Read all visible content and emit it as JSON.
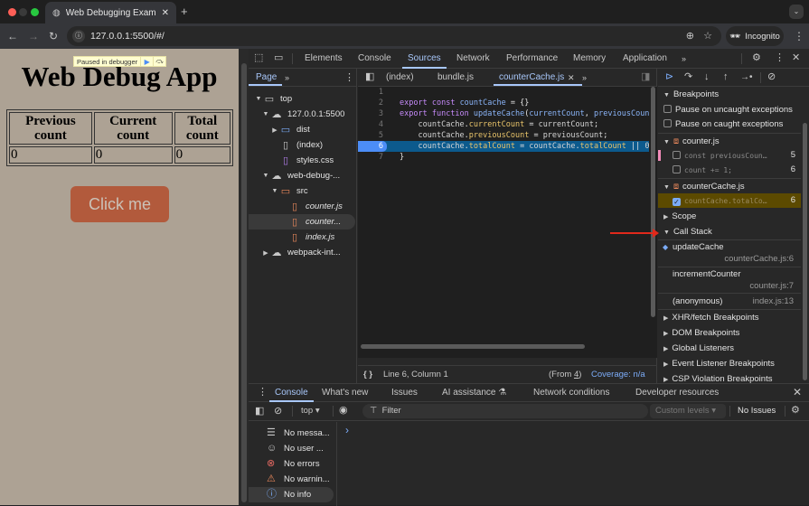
{
  "browser": {
    "tab_title": "Web Debugging Example",
    "url": "127.0.0.1:5500/#/",
    "incognito_label": "Incognito",
    "colors": {
      "close": "#ff5f57",
      "minimize": "#3a3a3a",
      "maximize": "#28c840"
    }
  },
  "page": {
    "paused_label": "Paused in debugger",
    "heading": "Web Debug App",
    "table": {
      "headers": [
        [
          "Previous",
          "count"
        ],
        [
          "Current",
          "count"
        ],
        [
          "Total",
          "count"
        ]
      ],
      "values": [
        "0",
        "0",
        "0"
      ]
    },
    "button_label": "Click me",
    "colors": {
      "background": "#ada294",
      "button": "#b25a3c"
    }
  },
  "devtools": {
    "main_tabs": [
      "Elements",
      "Console",
      "Sources",
      "Network",
      "Performance",
      "Memory",
      "Application"
    ],
    "active_main_tab": "Sources",
    "navigator": {
      "tab": "Page",
      "tree": [
        {
          "label": "top",
          "type": "frame",
          "expanded": true
        },
        {
          "label": "127.0.0.1:5500",
          "type": "domain",
          "expanded": true
        },
        {
          "label": "dist",
          "type": "folder",
          "expanded": false
        },
        {
          "label": "(index)",
          "type": "file"
        },
        {
          "label": "styles.css",
          "type": "css"
        },
        {
          "label": "web-debug-...",
          "type": "domain",
          "expanded": true
        },
        {
          "label": "src",
          "type": "folder",
          "expanded": true
        },
        {
          "label": "counter.js",
          "type": "js"
        },
        {
          "label": "counter...",
          "type": "js",
          "selected": true
        },
        {
          "label": "index.js",
          "type": "js"
        },
        {
          "label": "webpack-int...",
          "type": "domain",
          "expanded": false
        }
      ]
    },
    "editor": {
      "tabs": [
        "(index)",
        "bundle.js",
        "counterCache.js"
      ],
      "active_tab": "counterCache.js",
      "lines": [
        {
          "n": "1",
          "code": ""
        },
        {
          "n": "2",
          "code": "export const countCache = {}"
        },
        {
          "n": "3",
          "code": "export function updateCache(currentCount, previousCount"
        },
        {
          "n": "4",
          "code": "    countCache.currentCount = currentCount;"
        },
        {
          "n": "5",
          "code": "    countCache.previousCount = previousCount;"
        },
        {
          "n": "6",
          "code": "    countCache.totalCount = countCache.totalCount || 0"
        },
        {
          "n": "7",
          "code": "}"
        }
      ],
      "paused_line": "6",
      "status": {
        "position": "Line 6, Column 1",
        "from_prefix": "(From ",
        "from_link": "4",
        "from_suffix": ")",
        "coverage": "Coverage: n/a"
      }
    },
    "debugger": {
      "breakpoints_title": "Breakpoints",
      "pause_uncaught": "Pause on uncaught exceptions",
      "pause_caught": "Pause on caught exceptions",
      "files": [
        {
          "name": "counter.js",
          "items": [
            {
              "code": "const previousCoun…",
              "line": "5",
              "checked": false
            },
            {
              "code": "count += 1;",
              "line": "6",
              "checked": false
            }
          ]
        },
        {
          "name": "counterCache.js",
          "items": [
            {
              "code": "countCache.totalCo…",
              "line": "6",
              "checked": true
            }
          ]
        }
      ],
      "scope_title": "Scope",
      "call_stack_title": "Call Stack",
      "call_stack": [
        {
          "fn": "updateCache",
          "loc": "counterCache.js:6",
          "current": true
        },
        {
          "fn": "incrementCounter",
          "loc": "counter.js:7"
        },
        {
          "fn": "(anonymous)",
          "loc": "index.js:13"
        }
      ],
      "sections": [
        "XHR/fetch Breakpoints",
        "DOM Breakpoints",
        "Global Listeners",
        "Event Listener Breakpoints",
        "CSP Violation Breakpoints"
      ]
    },
    "drawer": {
      "tabs": [
        "Console",
        "What's new",
        "Issues",
        "AI assistance",
        "Network conditions",
        "Developer resources"
      ],
      "active_tab": "Console",
      "context": "top",
      "filter_placeholder": "Filter",
      "levels": "Custom levels",
      "issues": "No Issues",
      "sidebar": [
        {
          "label": "No messa...",
          "icon": "list-icon"
        },
        {
          "label": "No user ...",
          "icon": "user-icon"
        },
        {
          "label": "No errors",
          "icon": "error-icon"
        },
        {
          "label": "No warnin...",
          "icon": "warning-icon"
        },
        {
          "label": "No info",
          "icon": "info-icon",
          "selected": true
        }
      ],
      "prompt": "›"
    }
  }
}
